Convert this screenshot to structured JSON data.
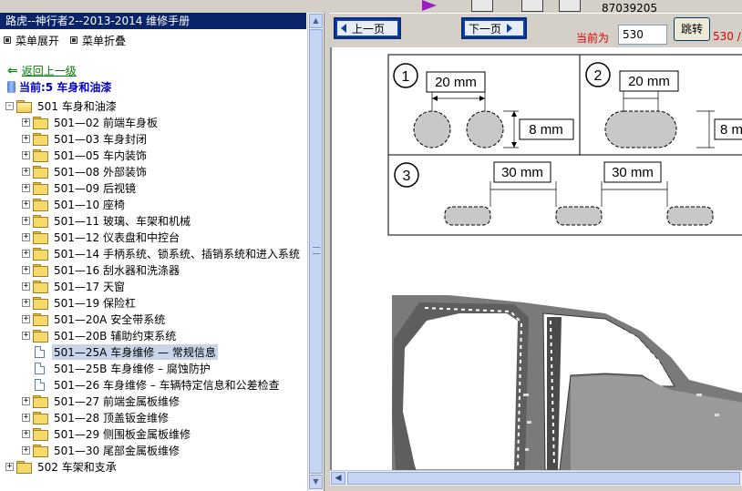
{
  "window": {
    "title": "路虎--神行者2--2013-2014 维修手册",
    "phone": "87039205"
  },
  "menu": {
    "expand_label": "菜单展开",
    "collapse_label": "菜单折叠"
  },
  "back_link": "返回上一级",
  "current": "当前:5 车身和油漆",
  "tree": [
    {
      "label": "501 车身和油漆",
      "level": 0,
      "type": "folder",
      "open": true,
      "toggle": "-"
    },
    {
      "label": "501—02 前端车身板",
      "level": 1,
      "type": "folder",
      "toggle": "+"
    },
    {
      "label": "501—03 车身封闭",
      "level": 1,
      "type": "folder",
      "toggle": "+"
    },
    {
      "label": "501—05 车内装饰",
      "level": 1,
      "type": "folder",
      "toggle": "+"
    },
    {
      "label": "501—08 外部装饰",
      "level": 1,
      "type": "folder",
      "toggle": "+"
    },
    {
      "label": "501—09 后视镜",
      "level": 1,
      "type": "folder",
      "toggle": "+"
    },
    {
      "label": "501—10 座椅",
      "level": 1,
      "type": "folder",
      "toggle": "+"
    },
    {
      "label": "501—11 玻璃、车架和机械",
      "level": 1,
      "type": "folder",
      "toggle": "+"
    },
    {
      "label": "501—12 仪表盘和中控台",
      "level": 1,
      "type": "folder",
      "toggle": "+"
    },
    {
      "label": "501—14 手柄系统、锁系统、插销系统和进入系统",
      "level": 1,
      "type": "folder",
      "toggle": "+"
    },
    {
      "label": "501—16 刮水器和洗涤器",
      "level": 1,
      "type": "folder",
      "toggle": "+"
    },
    {
      "label": "501—17 天窗",
      "level": 1,
      "type": "folder",
      "toggle": "+"
    },
    {
      "label": "501—19 保险杠",
      "level": 1,
      "type": "folder",
      "toggle": "+"
    },
    {
      "label": "501—20A 安全带系统",
      "level": 1,
      "type": "folder",
      "toggle": "+"
    },
    {
      "label": "501—20B 辅助约束系统",
      "level": 1,
      "type": "folder",
      "toggle": "+"
    },
    {
      "label": "501—25A 车身维修 — 常规信息",
      "level": 1,
      "type": "doc",
      "selected": true
    },
    {
      "label": "501—25B 车身维修 – 腐蚀防护",
      "level": 1,
      "type": "doc"
    },
    {
      "label": "501—26 车身维修 – 车辆特定信息和公差检查",
      "level": 1,
      "type": "doc"
    },
    {
      "label": "501—27 前端金属板维修",
      "level": 1,
      "type": "folder",
      "toggle": "+"
    },
    {
      "label": "501—28 顶盖钣金维修",
      "level": 1,
      "type": "folder",
      "toggle": "+"
    },
    {
      "label": "501—29 侧围板金属板维修",
      "level": 1,
      "type": "folder",
      "toggle": "+"
    },
    {
      "label": "501—30 尾部金属板维修",
      "level": 1,
      "type": "folder",
      "toggle": "+"
    },
    {
      "label": "502 车架和支承",
      "level": 0,
      "type": "folder",
      "toggle": "+"
    }
  ],
  "nav": {
    "prev_label": "上一页",
    "next_label": "下一页",
    "current_label": "当前为",
    "page_value": "530",
    "jump_label": "跳转",
    "total_label": "530 /"
  },
  "diagram": {
    "panel1_num": "1",
    "panel2_num": "2",
    "panel3_num": "3",
    "dim_20": "20 mm",
    "dim_20b": "20 mm",
    "dim_8": "8 mm",
    "dim_8b": "8 m",
    "dim_30": "30 mm",
    "dim_30b": "30 mm"
  },
  "colors": {
    "title_bg": "#0a246a",
    "nav_blue": "#0a40a8",
    "red_text": "#e00000",
    "link_green": "#007a00",
    "current_blue": "#0000cc"
  }
}
